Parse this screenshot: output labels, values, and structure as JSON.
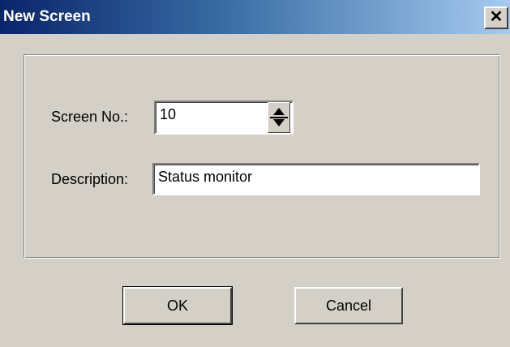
{
  "window": {
    "title": "New Screen",
    "close_glyph": "✕"
  },
  "form": {
    "screen_no_label": "Screen No.:",
    "screen_no_value": "10",
    "description_label": "Description:",
    "description_value": "Status monitor"
  },
  "buttons": {
    "ok_label": "OK",
    "cancel_label": "Cancel"
  },
  "colors": {
    "face": "#d4d0c8",
    "title_start": "#0a246a",
    "title_end": "#a6caf0"
  }
}
